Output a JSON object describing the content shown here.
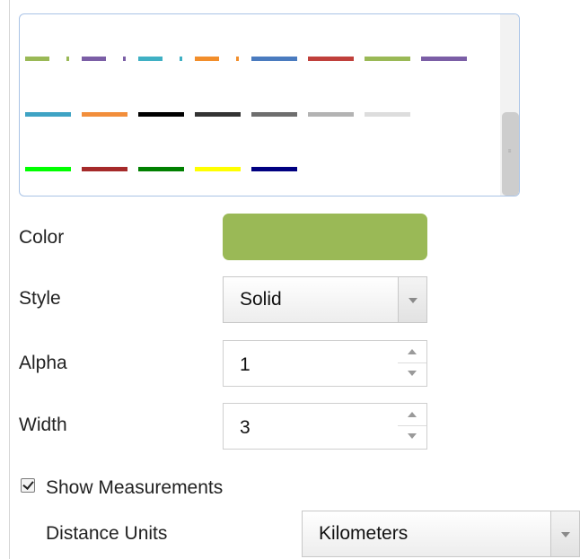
{
  "palette": {
    "rows": [
      [
        {
          "color": "#9ab956",
          "dash": "dash-dot"
        },
        {
          "color": "#7b5ea6",
          "dash": "dash-dot"
        },
        {
          "color": "#3fb0c4",
          "dash": "dash-dot"
        },
        {
          "color": "#f28e2b",
          "dash": "dash-dot"
        },
        {
          "color": "#4a7bbf",
          "dash": "solid"
        },
        {
          "color": "#c0403b",
          "dash": "solid"
        },
        {
          "color": "#9ab956",
          "dash": "solid"
        },
        {
          "color": "#7b5ea6",
          "dash": "solid"
        }
      ],
      [
        {
          "color": "#3fa3c4",
          "dash": "solid"
        },
        {
          "color": "#f28e3b",
          "dash": "solid"
        },
        {
          "color": "#000000",
          "dash": "solid"
        },
        {
          "color": "#333333",
          "dash": "solid"
        },
        {
          "color": "#6e6e6e",
          "dash": "solid"
        },
        {
          "color": "#b3b3b3",
          "dash": "solid"
        },
        {
          "color": "#dddddd",
          "dash": "solid"
        }
      ],
      [
        {
          "color": "#00ff00",
          "dash": "solid"
        },
        {
          "color": "#a52a2a",
          "dash": "solid"
        },
        {
          "color": "#008000",
          "dash": "solid"
        },
        {
          "color": "#ffff00",
          "dash": "solid"
        },
        {
          "color": "#000080",
          "dash": "solid"
        }
      ]
    ]
  },
  "color": {
    "label": "Color",
    "value": "#9ab956"
  },
  "style": {
    "label": "Style",
    "value": "Solid"
  },
  "alpha": {
    "label": "Alpha",
    "value": "1"
  },
  "width": {
    "label": "Width",
    "value": "3"
  },
  "show_measurements": {
    "label": "Show Measurements",
    "checked": true
  },
  "distance_units": {
    "label": "Distance Units",
    "value": "Kilometers"
  },
  "icons": {
    "scroll_grip": "scroll-grip-icon",
    "dropdown": "chevron-down-icon",
    "spin_up": "arrow-up-icon",
    "spin_down": "arrow-down-icon",
    "check": "check-icon"
  }
}
